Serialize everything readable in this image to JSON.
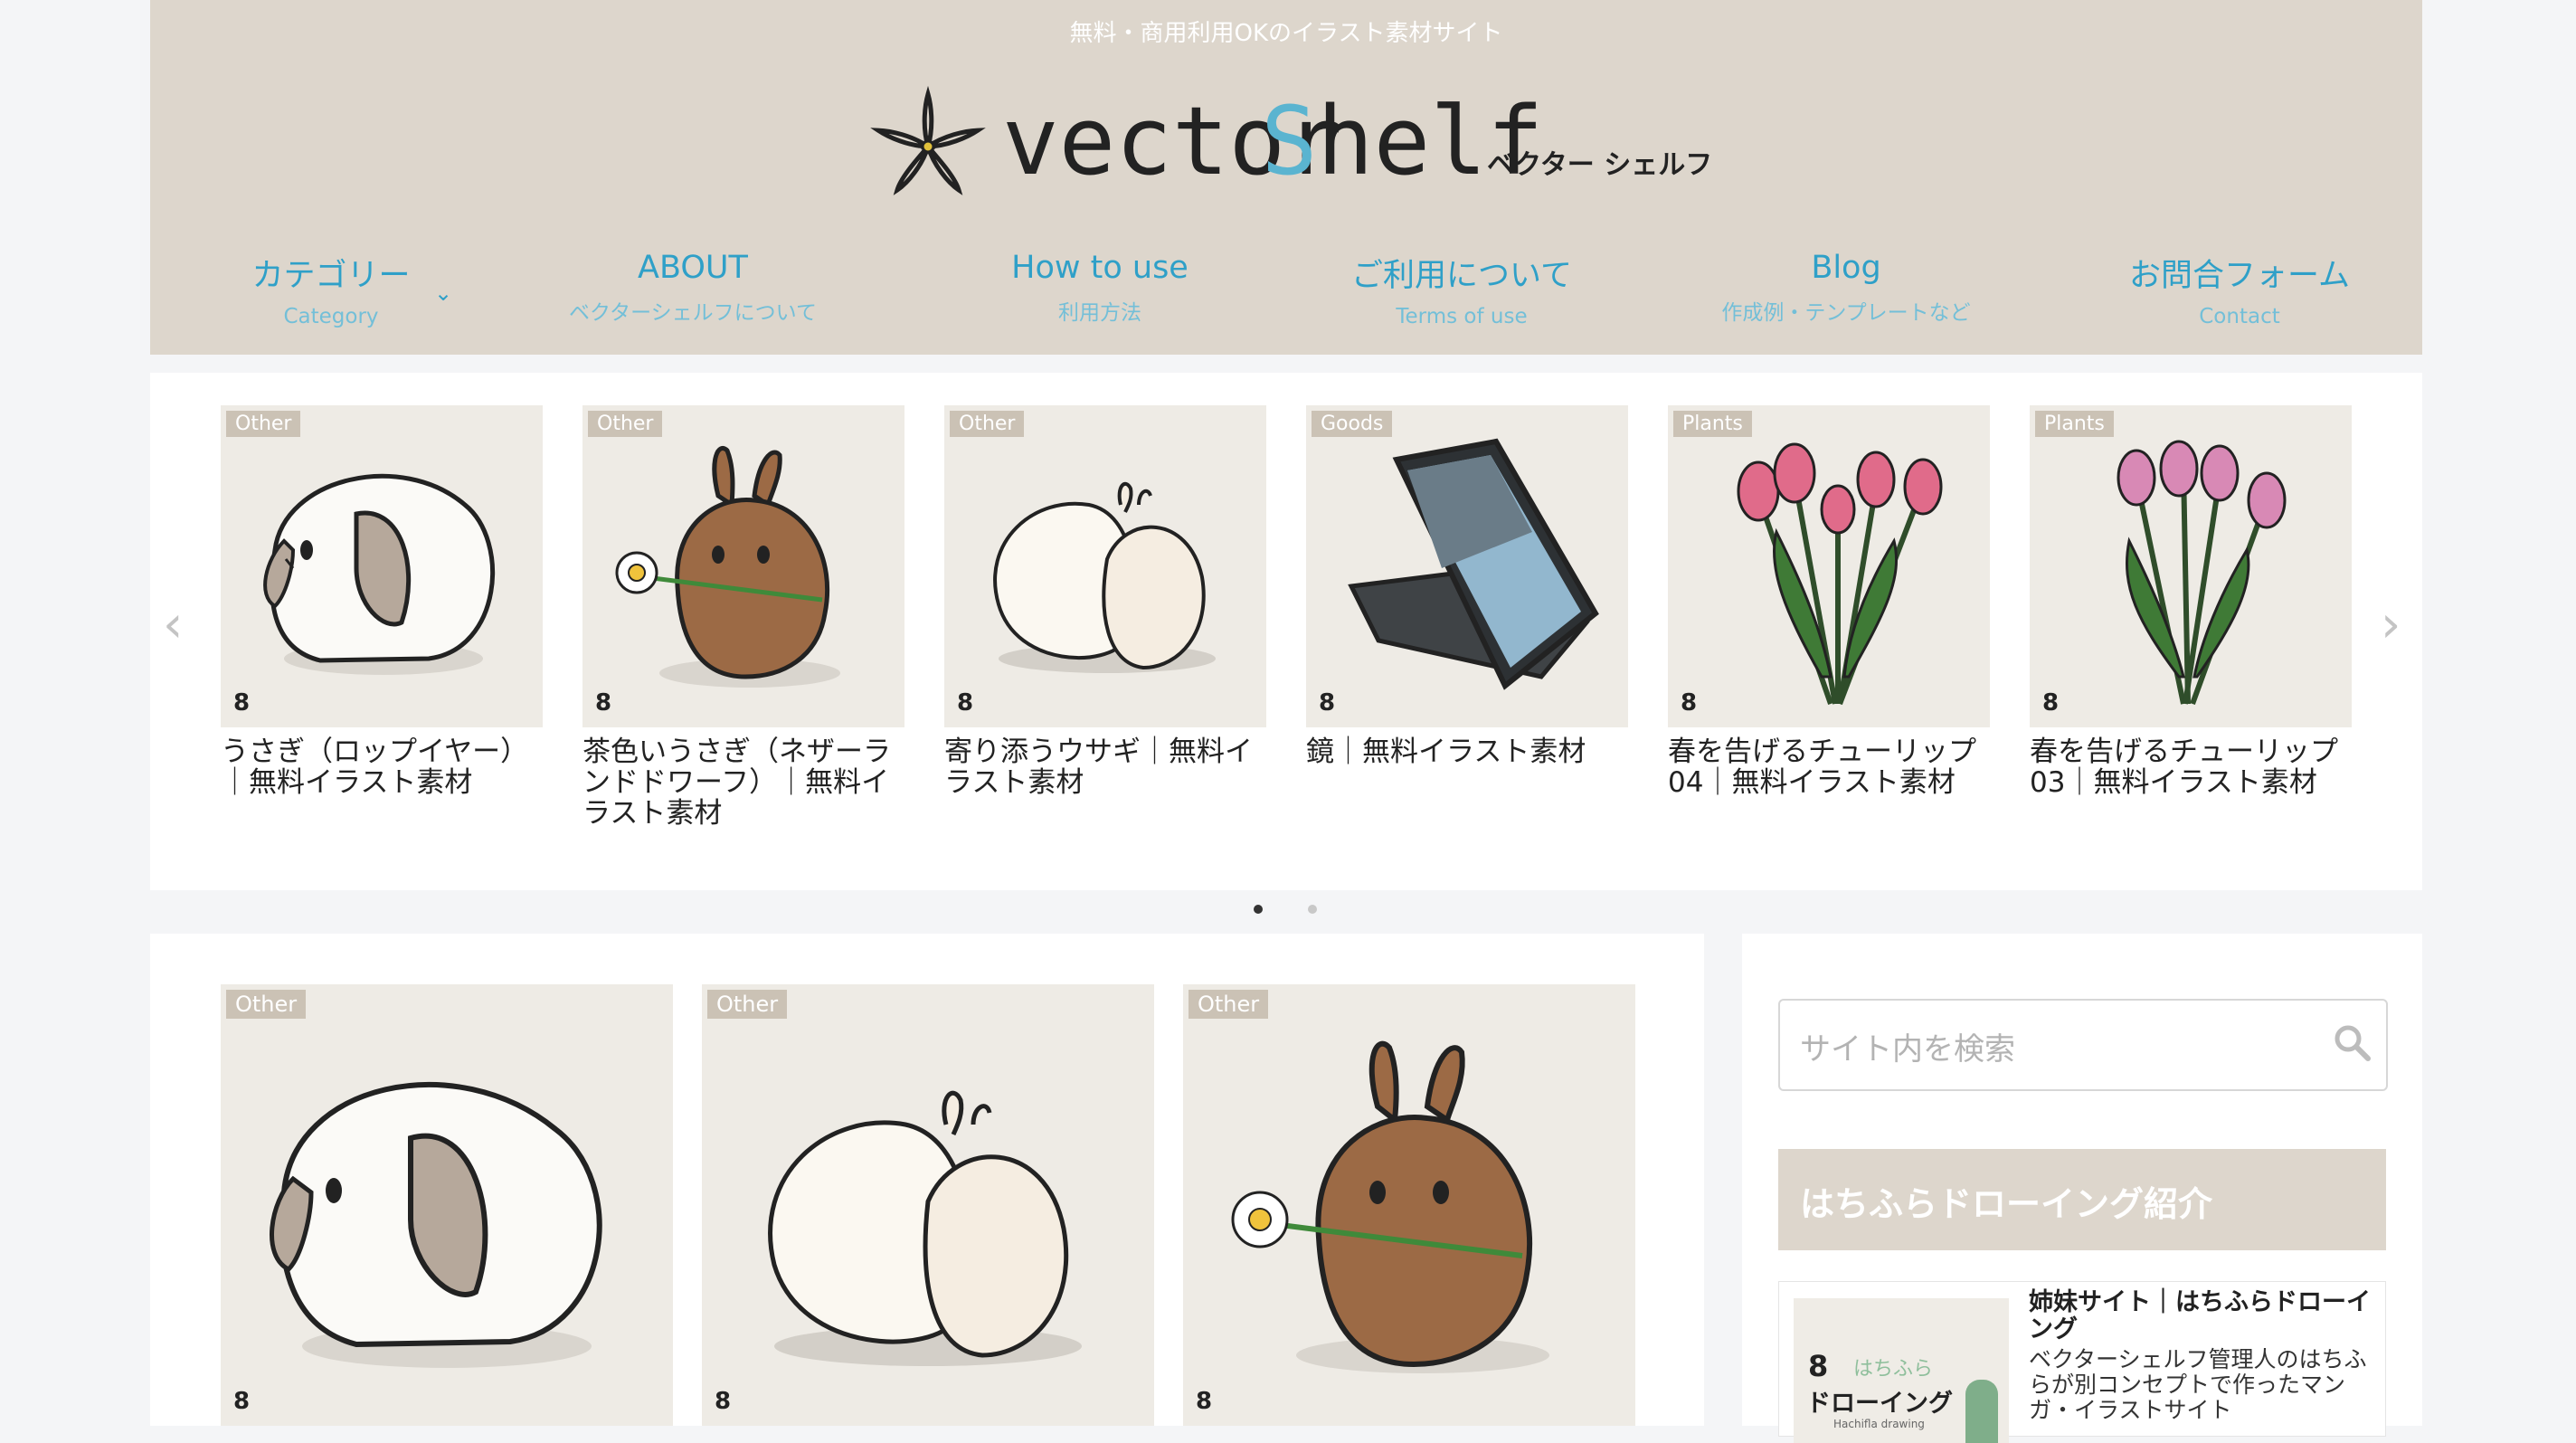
{
  "header": {
    "tagline": "無料・商用利用OKのイラスト素材サイト",
    "logo": {
      "text_left": "vector",
      "text_accent": "S",
      "text_right": "helf",
      "kana": "ベクター シェルフ"
    },
    "nav": [
      {
        "label": "カテゴリー",
        "sub": "Category",
        "has_dropdown": true
      },
      {
        "label": "ABOUT",
        "sub": "ベクターシェルフについて"
      },
      {
        "label": "How to use",
        "sub": "利用方法"
      },
      {
        "label": "ご利用について",
        "sub": "Terms of use"
      },
      {
        "label": "Blog",
        "sub": "作成例・テンプレートなど"
      },
      {
        "label": "お問合フォーム",
        "sub": "Contact"
      }
    ],
    "nav_chevron": "⌄"
  },
  "carousel": {
    "prev": "‹",
    "next": "›",
    "items": [
      {
        "tag": "Other",
        "title": "うさぎ（ロップイヤー）｜無料イラスト素材",
        "image": "lop-rabbit"
      },
      {
        "tag": "Other",
        "title": "茶色いうさぎ（ネザーランドドワーフ）｜無料イラスト素材",
        "image": "brown-rabbit"
      },
      {
        "tag": "Other",
        "title": "寄り添うウサギ｜無料イラスト素材",
        "image": "cuddling-rabbits"
      },
      {
        "tag": "Goods",
        "title": "鏡｜無料イラスト素材",
        "image": "mirror"
      },
      {
        "tag": "Plants",
        "title": "春を告げるチューリップ04｜無料イラスト素材",
        "image": "tulips-red"
      },
      {
        "tag": "Plants",
        "title": "春を告げるチューリップ03｜無料イラスト素材",
        "image": "tulips-pink"
      }
    ],
    "watermark": "8",
    "dots": {
      "count": 2,
      "active": 1
    }
  },
  "main": {
    "cards": [
      {
        "tag": "Other",
        "image": "lop-rabbit"
      },
      {
        "tag": "Other",
        "image": "cuddling-rabbits"
      },
      {
        "tag": "Other",
        "image": "brown-rabbit"
      }
    ]
  },
  "sidebar": {
    "search_placeholder": "サイト内を検索",
    "widget_title": "はちふらドローイング紹介",
    "sister": {
      "title": "姉妹サイト｜はちふらドローイング",
      "desc": "ベクターシェルフ管理人のはちふらが別コンセプトで作ったマンガ・イラストサイト",
      "thumb_text_1": "はちふら",
      "thumb_text_2": "ドローイング",
      "thumb_text_3": "Hachifla drawing"
    }
  },
  "colors": {
    "header_bg": "#ddd6cc",
    "nav_text": "#2fa0c8",
    "accent_blue": "#5ab4d0",
    "card_bg": "#eeebe5",
    "tag_bg": "#cbc2b5"
  }
}
